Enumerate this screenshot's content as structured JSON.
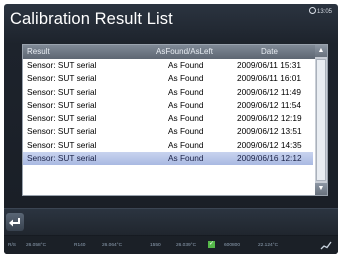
{
  "header": {
    "title": "Calibration Result List",
    "clock": "13:05"
  },
  "table": {
    "columns": [
      "Result",
      "AsFound/AsLeft",
      "Date"
    ],
    "rows": [
      {
        "result": "Sensor: SUT serial",
        "state": "As Found",
        "date": "2009/06/11 15:31"
      },
      {
        "result": "Sensor: SUT serial",
        "state": "As Found",
        "date": "2009/06/11 16:01"
      },
      {
        "result": "Sensor: SUT serial",
        "state": "As Found",
        "date": "2009/06/12 11:49"
      },
      {
        "result": "Sensor: SUT serial",
        "state": "As Found",
        "date": "2009/06/12 11:54"
      },
      {
        "result": "Sensor: SUT serial",
        "state": "As Found",
        "date": "2009/06/12 12:19"
      },
      {
        "result": "Sensor: SUT serial",
        "state": "As Found",
        "date": "2009/06/12 13:51"
      },
      {
        "result": "Sensor: SUT serial",
        "state": "As Found",
        "date": "2009/06/12 14:35"
      },
      {
        "result": "Sensor: SUT serial",
        "state": "As Found",
        "date": "2009/06/16 12:12"
      }
    ],
    "selected_index": 7
  },
  "status_bar": {
    "items": [
      "R/S",
      "26.058°C",
      "R140",
      "26.064°C",
      "1550",
      "26.039°C",
      "600800",
      "22.124°C"
    ],
    "green_badge": "✓"
  },
  "colors": {
    "background": "#1d232c",
    "selected_row": "#a9b9e2",
    "header": "#6a7380"
  },
  "icons": [
    "clock-icon",
    "back-arrow-icon",
    "scroll-up-icon",
    "scroll-down-icon",
    "signal-icon"
  ]
}
